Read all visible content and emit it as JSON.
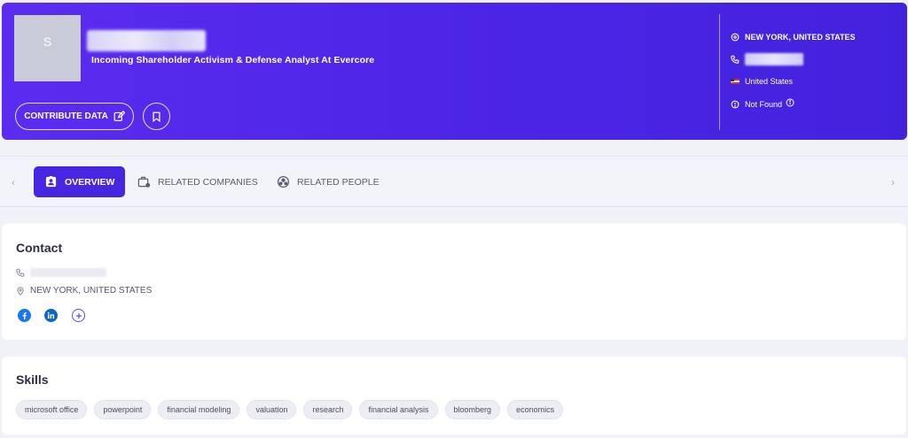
{
  "profile": {
    "avatar_initial": "S",
    "headline": "Incoming Shareholder Activism & Defense Analyst At Evercore",
    "contribute_label": "CONTRIBUTE DATA"
  },
  "side_info": {
    "location": "NEW YORK, UNITED STATES",
    "country": "United States",
    "email_status": "Not Found"
  },
  "tabs": [
    {
      "label": "OVERVIEW"
    },
    {
      "label": "RELATED COMPANIES"
    },
    {
      "label": "RELATED PEOPLE"
    }
  ],
  "contact": {
    "title": "Contact",
    "location": "NEW YORK, UNITED STATES"
  },
  "skills": {
    "title": "Skills",
    "items": [
      "microsoft office",
      "powerpoint",
      "financial modeling",
      "valuation",
      "research",
      "financial analysis",
      "bloomberg",
      "economics"
    ]
  },
  "colors": {
    "hero": "#4b25e6",
    "accent": "#4726e2",
    "facebook": "#1877f2",
    "linkedin": "#0a66c2"
  }
}
